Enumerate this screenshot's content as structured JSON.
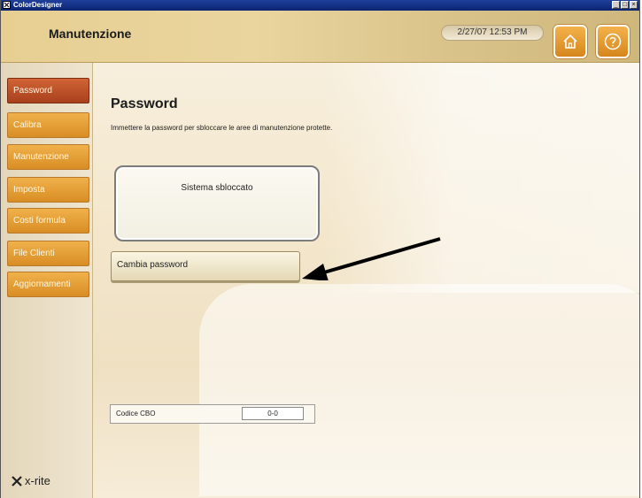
{
  "window": {
    "title": "ColorDesigner",
    "controls": [
      "_",
      "□",
      "×"
    ]
  },
  "header": {
    "title": "Manutenzione",
    "datetime": "2/27/07 12:53 PM",
    "icons": [
      "home-icon",
      "help-icon"
    ]
  },
  "sidebar": {
    "items": [
      {
        "label": "Password",
        "active": true
      },
      {
        "label": "Calibra",
        "active": false
      },
      {
        "label": "Manutenzione",
        "active": false
      },
      {
        "label": "Imposta",
        "active": false
      },
      {
        "label": "Costi formula",
        "active": false
      },
      {
        "label": "File Clienti",
        "active": false
      },
      {
        "label": "Aggiornamenti",
        "active": false
      }
    ],
    "logo": "x-rite"
  },
  "main": {
    "title": "Password",
    "description": "Immettere la password per sbloccare le aree di manutenzione protette.",
    "status": "Sistema sbloccato",
    "change_button": "Cambia password",
    "cbo": {
      "label": "Codice CBO",
      "value": "0-0"
    }
  },
  "colors": {
    "accent_orange": "#d98d24",
    "active_red": "#a8401d",
    "titlebar_blue": "#0a2470"
  }
}
